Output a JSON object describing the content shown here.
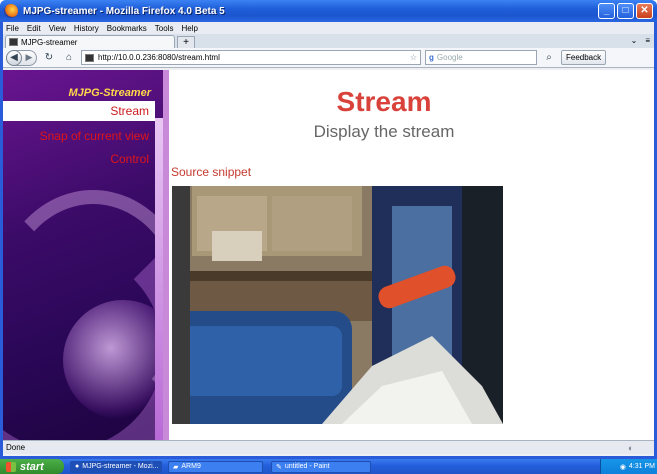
{
  "window": {
    "title": "MJPG-streamer - Mozilla Firefox 4.0 Beta 5",
    "min": "_",
    "max": "□",
    "close": "✕"
  },
  "menu": [
    "File",
    "Edit",
    "View",
    "History",
    "Bookmarks",
    "Tools",
    "Help"
  ],
  "tab": {
    "label": "MJPG-streamer",
    "new_tab": "+",
    "right_icons": [
      "⌄",
      "≡"
    ]
  },
  "nav": {
    "url": "http://10.0.0.236:8080/stream.html",
    "search_placeholder": "Google",
    "feedback": "Feedback"
  },
  "sidebar": {
    "brand": "MJPG-Streamer",
    "items": [
      "Stream",
      "Snap of current view",
      "Control"
    ]
  },
  "page": {
    "title": "Stream",
    "subtitle": "Display the stream",
    "snippet_link": "Source snippet"
  },
  "status": {
    "text": "Done"
  },
  "taskbar": {
    "start": "start",
    "items": [
      "MJPG-streamer - Mozi...",
      "ARM9",
      "untitled - Paint"
    ],
    "clock": "4:31 PM"
  }
}
